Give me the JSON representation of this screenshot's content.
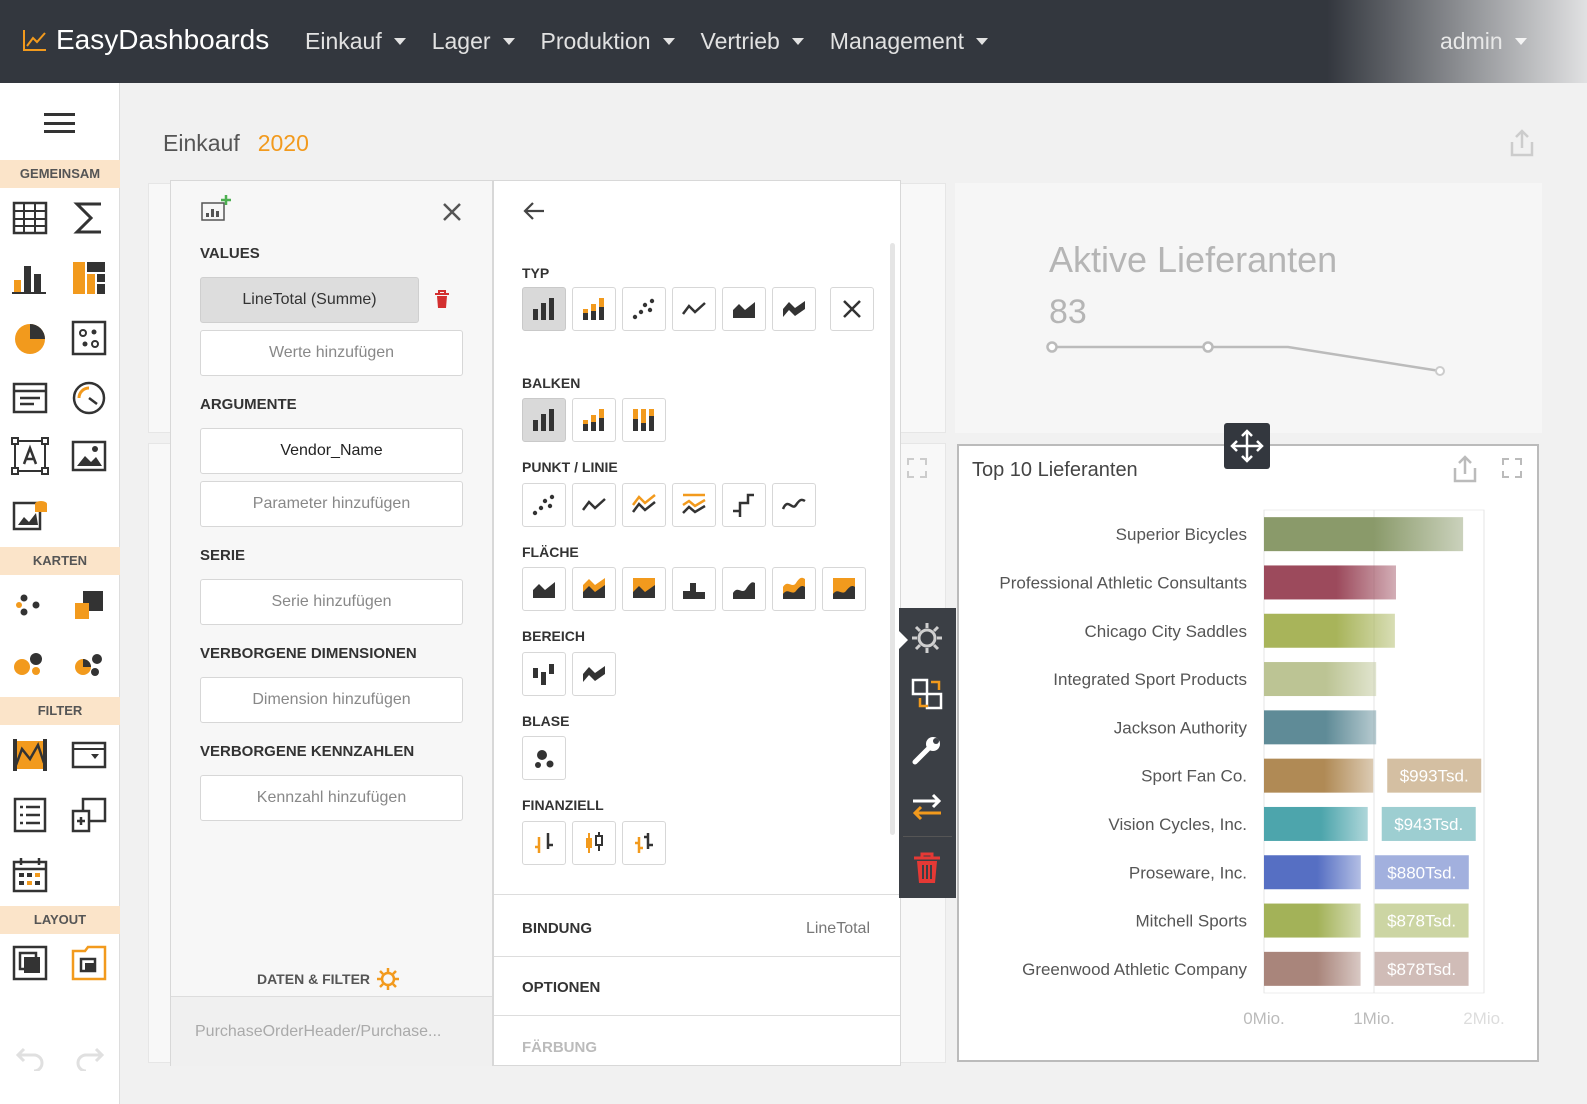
{
  "app": {
    "title": "EasyDashboards",
    "nav": [
      "Einkauf",
      "Lager",
      "Produktion",
      "Vertrieb",
      "Management"
    ],
    "user": "admin"
  },
  "sidebar": {
    "sections": [
      "GEMEINSAM",
      "KARTEN",
      "FILTER",
      "LAYOUT"
    ]
  },
  "page": {
    "title": "Einkauf",
    "year": "2020"
  },
  "kpi": {
    "title": "Aktive Lieferanten",
    "value": "83"
  },
  "binding_panel": {
    "values_label": "VALUES",
    "value_item": "LineTotal (Summe)",
    "add_value": "Werte hinzufügen",
    "arguments_label": "ARGUMENTE",
    "argument_item": "Vendor_Name",
    "add_parameter": "Parameter hinzufügen",
    "series_label": "SERIE",
    "add_series": "Serie hinzufügen",
    "hidden_dims_label": "VERBORGENE DIMENSIONEN",
    "add_dim": "Dimension hinzufügen",
    "hidden_measures_label": "VERBORGENE KENNZAHLEN",
    "add_measure": "Kennzahl hinzufügen",
    "data_filter": "DATEN & FILTER",
    "datasource": "PurchaseOrderHeader/Purchase..."
  },
  "type_panel": {
    "sections": [
      "TYP",
      "BALKEN",
      "PUNKT / LINIE",
      "FLÄCHE",
      "BEREICH",
      "BLASE",
      "FINANZIELL"
    ],
    "binding_label": "BINDUNG",
    "binding_value": "LineTotal",
    "options_label": "OPTIONEN",
    "coloring_label": "FÄRBUNG"
  },
  "chart_data": {
    "type": "bar",
    "title": "Top 10 Lieferanten",
    "categories": [
      "Superior Bicycles",
      "Professional Athletic Consultants",
      "Chicago City Saddles",
      "Integrated Sport Products",
      "Jackson Authority",
      "Sport Fan Co.",
      "Vision Cycles, Inc.",
      "Proseware, Inc.",
      "Mitchell Sports",
      "Greenwood Athletic Company"
    ],
    "values": [
      1810,
      1200,
      1190,
      1020,
      1020,
      993,
      943,
      880,
      878,
      878
    ],
    "data_labels": [
      "",
      "",
      "",
      "",
      "",
      "$993Tsd.",
      "$943Tsd.",
      "$880Tsd.",
      "$878Tsd.",
      "$878Tsd."
    ],
    "colors": [
      "#8a9a6a",
      "#9c4a5c",
      "#a8b45a",
      "#bcc494",
      "#5f8b97",
      "#b08a55",
      "#4da5ac",
      "#566fc3",
      "#a3b258",
      "#a9857b"
    ],
    "xlim": [
      0,
      2000
    ],
    "tick_labels": [
      "0Mio.",
      "1Mio.",
      "2Mio."
    ]
  }
}
